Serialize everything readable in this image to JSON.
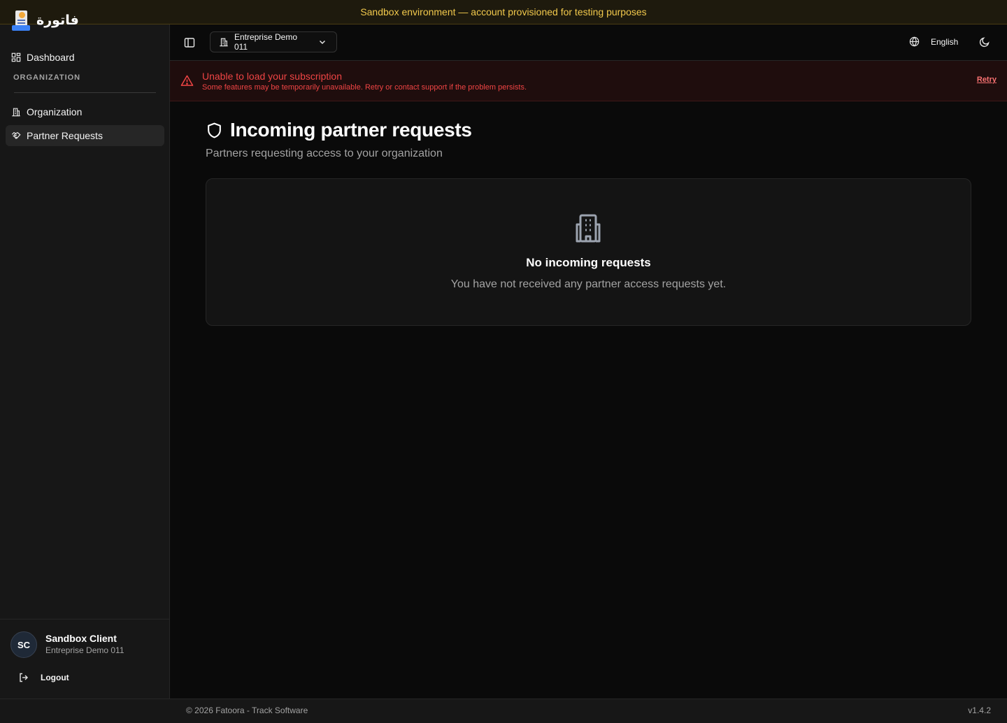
{
  "banner": {
    "text": "Sandbox environment — account provisioned for testing purposes"
  },
  "app": {
    "logo_text": "فاتورة"
  },
  "sidebar": {
    "items": [
      {
        "label": "Dashboard",
        "icon": "dashboard-grid-icon"
      },
      {
        "label": "Organization",
        "icon": "building-icon"
      },
      {
        "label": "Partner Requests",
        "icon": "handshake-icon",
        "active": true
      }
    ],
    "section_label": "ORGANIZATION"
  },
  "user": {
    "initials": "SC",
    "name": "Sandbox Client",
    "org": "Entreprise Demo 011",
    "logout_label": "Logout"
  },
  "header": {
    "org_switcher_label": "Entreprise Demo 011",
    "language_label": "English"
  },
  "alert": {
    "title": "Unable to load your subscription",
    "description": "Some features may be temporarily unavailable. Retry or contact support if the problem persists.",
    "retry_label": "Retry",
    "color": "#ef4444"
  },
  "main": {
    "title": "Incoming partner requests",
    "subtitle": "Partners requesting access to your organization",
    "empty_state": {
      "title": "No incoming requests",
      "description": "You have not received any partner access requests yet."
    }
  },
  "footer": {
    "copyright": "© 2026 Fatoora - Track Software",
    "version": "v1.4.2"
  }
}
